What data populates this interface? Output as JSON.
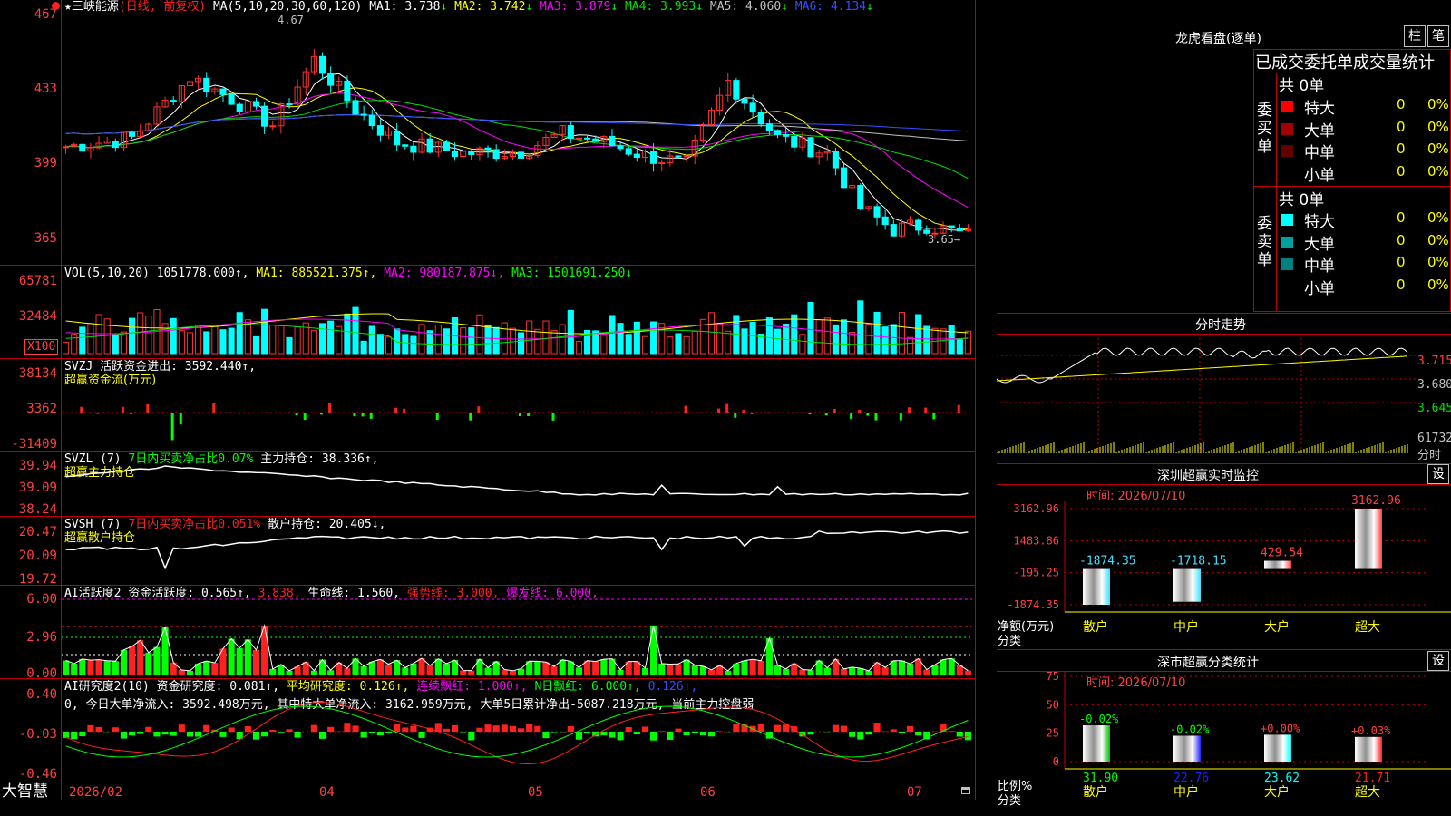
{
  "app": {
    "name": "大智慧",
    "stock_title": "三峡能源",
    "title_extra": "(日线, 前复权)",
    "ma_label": "MA(5,10,20,30,60,120)",
    "max_label": "4.67",
    "min_label": "3.65"
  },
  "ma": [
    {
      "name": "MA1:",
      "value": "3.738",
      "arrow": "↓",
      "color": "#ffffff"
    },
    {
      "name": "MA2:",
      "value": "3.742",
      "arrow": "↓",
      "color": "#ffff00"
    },
    {
      "name": "MA3:",
      "value": "3.879",
      "arrow": "↓",
      "color": "#ff00ff"
    },
    {
      "name": "MA4:",
      "value": "3.993",
      "arrow": "↓",
      "color": "#00e000"
    },
    {
      "name": "MA5:",
      "value": "4.060",
      "arrow": "↓",
      "color": "#c0c0c0"
    },
    {
      "name": "MA6:",
      "value": "4.134",
      "arrow": "↓",
      "color": "#3050ff"
    }
  ],
  "price_axis": [
    "467",
    "433",
    "399",
    "365"
  ],
  "vol": {
    "label": "VOL(5,10,20)",
    "value": "1051778.000↑,",
    "ma1": "MA1: 885521.375↑,",
    "ma2": "MA2: 980187.875↓,",
    "ma3": "MA3: 1501691.250↓",
    "axis": [
      "65781",
      "32484"
    ],
    "unit": "X100"
  },
  "svzj": {
    "label": "SVZJ  活跃资金进出: 3592.440↑,",
    "sub": "超赢资金流(万元)",
    "axis": [
      "38134",
      "3362",
      "-31409"
    ]
  },
  "svzl": {
    "label": "SVZL (7)",
    "ratio": "7日内买卖净占比0.07%",
    "pos": "主力持仓: 38.336↑,",
    "sub": "超赢主力持仓",
    "axis": [
      "39.94",
      "39.09",
      "38.24"
    ]
  },
  "svsh": {
    "label": "SVSH (7)",
    "ratio": "7日内买卖净占比0.051%",
    "pos": "散户持仓: 20.405↓,",
    "sub": "超赢散户持仓",
    "axis": [
      "20.47",
      "20.09",
      "19.72"
    ]
  },
  "ai1": {
    "label": "AI活跃度2",
    "a": "资金活跃度: 0.565↑,",
    "b": "3.838,",
    "c": "生命线: 1.560,",
    "d": "强势线: 3.000,",
    "e": "爆发线: 6.000,",
    "axis": [
      "6.00",
      "2.96",
      "0.00"
    ]
  },
  "ai2": {
    "label": "AI研究度2(10)",
    "a": "资金研究度: 0.081↑,",
    "b": "平均研究度: 0.126↑,",
    "c": "连续飘红: 1.000↑,",
    "d": "N日飘红: 6.000↑,",
    "e": "0.126↑,",
    "line2": "0, 今日大单净流入: 3592.498万元, 其中特大单净流入: 3162.959万元, 大单5日累计净出-5087.218万元, 当前主力控盘弱",
    "axis": [
      "0.40",
      "-0.03",
      "-0.46"
    ]
  },
  "dates": [
    "2026/02",
    "04",
    "05",
    "06",
    "07"
  ],
  "lhb": {
    "title": "龙虎看盘(逐单)",
    "btn1": "柱",
    "btn2": "笔",
    "header": "已成交委托单成交量统计",
    "buy_label": "委买单",
    "sell_label": "委卖单",
    "total": "共 0单",
    "buy": [
      {
        "name": "特大",
        "count": "0",
        "pct": "0%",
        "color": "#ff0000"
      },
      {
        "name": "大单",
        "count": "0",
        "pct": "0%",
        "color": "#a00000"
      },
      {
        "name": "中单",
        "count": "0",
        "pct": "0%",
        "color": "#600000"
      },
      {
        "name": "小单",
        "count": "0",
        "pct": "0%",
        "color": ""
      }
    ],
    "sell": [
      {
        "name": "特大",
        "count": "0",
        "pct": "0%",
        "color": "#00ffff"
      },
      {
        "name": "大单",
        "count": "0",
        "pct": "0%",
        "color": "#00a0a0"
      },
      {
        "name": "中单",
        "count": "0",
        "pct": "0%",
        "color": "#008080"
      },
      {
        "name": "小单",
        "count": "0",
        "pct": "0%",
        "color": ""
      }
    ]
  },
  "fenshi": {
    "title": "分时走势",
    "axis": [
      "3.715",
      "3.680",
      "3.645"
    ],
    "vol_label": "61732",
    "vol_sub": "分时"
  },
  "monitor": {
    "title": "深圳超赢实时监控",
    "btn": "设",
    "time": "时间: 2026/07/10",
    "axis": [
      "3162.96",
      "1483.86",
      "-195.25",
      "-1874.35"
    ],
    "ylabel": "净额(万元)",
    "xlabel": "分类",
    "bars": [
      {
        "name": "散户",
        "value": -1874.35,
        "label": "-1874.35",
        "color": "#40e0ff"
      },
      {
        "name": "中户",
        "value": -1718.15,
        "label": "-1718.15",
        "color": "#40e0ff"
      },
      {
        "name": "大户",
        "value": 429.54,
        "label": "429.54",
        "color": "#ff4040"
      },
      {
        "name": "超大",
        "value": 3162.96,
        "label": "3162.96",
        "color": "#ff4040"
      }
    ]
  },
  "classify": {
    "title": "深市超赢分类统计",
    "btn": "设",
    "time": "时间: 2026/07/10",
    "axis": [
      "75",
      "50",
      "25",
      "0"
    ],
    "ylabel": "比例%",
    "xlabel": "分类",
    "bars": [
      {
        "name": "散户",
        "value": 31.9,
        "label": "31.90",
        "delta": "-0.02%",
        "color": "#00c000"
      },
      {
        "name": "中户",
        "value": 22.76,
        "label": "22.76",
        "delta": "-0.02%",
        "color": "#2020ff"
      },
      {
        "name": "大户",
        "value": 23.62,
        "label": "23.62",
        "delta": "+0.00%",
        "color": "#00ffff"
      },
      {
        "name": "超大",
        "value": 21.71,
        "label": "21.71",
        "delta": "+0.03%",
        "color": "#ff2020"
      }
    ]
  }
}
